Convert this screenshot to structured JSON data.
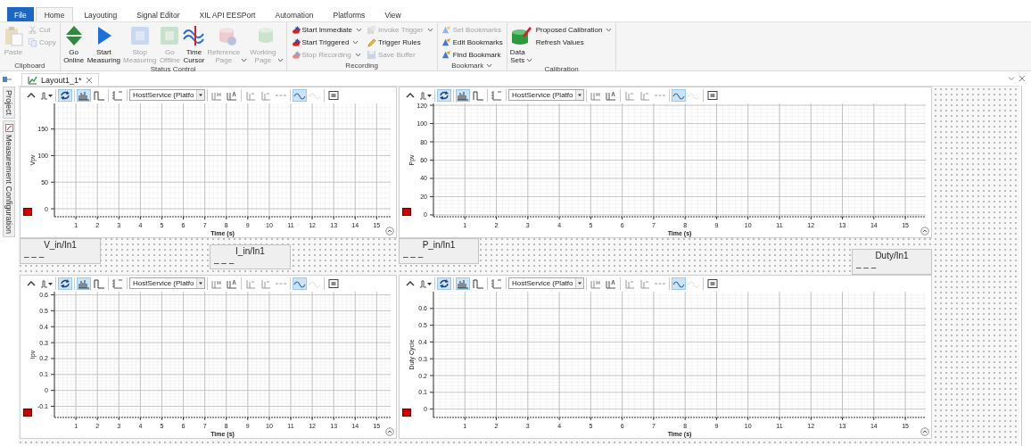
{
  "ribbon_tabs": [
    {
      "label": "File",
      "kind": "file",
      "selected": false
    },
    {
      "label": "Home",
      "kind": "tab",
      "selected": true
    },
    {
      "label": "Layouting",
      "kind": "tab",
      "selected": false
    },
    {
      "label": "Signal Editor",
      "kind": "tab",
      "selected": false
    },
    {
      "label": "XIL API EESPort",
      "kind": "tab",
      "selected": false
    },
    {
      "label": "Automation",
      "kind": "tab",
      "selected": false
    },
    {
      "label": "Platforms",
      "kind": "tab",
      "selected": false
    },
    {
      "label": "View",
      "kind": "tab",
      "selected": false
    }
  ],
  "ribbon_groups": [
    {
      "title": "Clipboard",
      "launcher": false,
      "columns": [
        {
          "kind": "large",
          "label": "Paste",
          "disabled": true,
          "dropdown": false
        },
        {
          "kind": "stack",
          "items": [
            {
              "label": "Cut",
              "disabled": true,
              "dropdown": false
            },
            {
              "label": "Copy",
              "disabled": true,
              "dropdown": false
            }
          ]
        }
      ]
    },
    {
      "title": "Status Control",
      "launcher": false,
      "columns": [
        {
          "kind": "large",
          "label": "Go Online",
          "disabled": false,
          "dropdown": false
        },
        {
          "kind": "large",
          "label": "Start Measuring",
          "disabled": false,
          "dropdown": false
        },
        {
          "kind": "large",
          "label": "Stop Measuring",
          "disabled": true,
          "dropdown": false
        },
        {
          "kind": "large",
          "label": "Go Offline",
          "disabled": true,
          "dropdown": false
        },
        {
          "kind": "large",
          "label": "Time Cursor",
          "disabled": false,
          "dropdown": false
        },
        {
          "kind": "large",
          "label": "Reference Page",
          "disabled": true,
          "dropdown": true
        },
        {
          "kind": "large",
          "label": "Working Page",
          "disabled": true,
          "dropdown": true
        }
      ]
    },
    {
      "title": "Recording",
      "launcher": false,
      "columns": [
        {
          "kind": "stack",
          "items": [
            {
              "label": "Start Immediate",
              "disabled": false,
              "dropdown": true
            },
            {
              "label": "Start Triggered",
              "disabled": false,
              "dropdown": true
            },
            {
              "label": "Stop Recording",
              "disabled": true,
              "dropdown": true
            }
          ]
        },
        {
          "kind": "stack",
          "items": [
            {
              "label": "Invoke Trigger",
              "disabled": true,
              "dropdown": true
            },
            {
              "label": "Trigger Rules",
              "disabled": false,
              "dropdown": false
            },
            {
              "label": "Save Buffer",
              "disabled": true,
              "dropdown": false
            }
          ]
        }
      ]
    },
    {
      "title": "Bookmark",
      "launcher": true,
      "columns": [
        {
          "kind": "stack",
          "items": [
            {
              "label": "Set Bookmarks",
              "disabled": true,
              "dropdown": false
            },
            {
              "label": "Edit Bookmarks",
              "disabled": false,
              "dropdown": false
            },
            {
              "label": "Find Bookmark",
              "disabled": false,
              "dropdown": false
            }
          ]
        }
      ]
    },
    {
      "title": "Calibration",
      "launcher": false,
      "columns": [
        {
          "kind": "large",
          "label": "Data Sets",
          "disabled": false,
          "dropdown": true
        },
        {
          "kind": "stack",
          "items": [
            {
              "label": "Proposed Calibration",
              "disabled": false,
              "dropdown": true
            },
            {
              "label": "Refresh Values",
              "disabled": false,
              "dropdown": false
            }
          ]
        }
      ]
    }
  ],
  "document_tab": {
    "label": "Layout1_1*"
  },
  "side_tabs": [
    {
      "label": "Project"
    },
    {
      "label": "Measurement Configuration"
    }
  ],
  "instruments": [
    {
      "kind": "plot",
      "toolbar": [
        [
          {
            "kind": "collapse",
            "on": false
          },
          {
            "kind": "signal-menu",
            "on": false
          }
        ],
        [
          {
            "kind": "refresh",
            "on": true
          }
        ],
        [
          {
            "kind": "bars",
            "on": true
          },
          {
            "kind": "step",
            "on": false
          }
        ],
        [
          {
            "kind": "axis",
            "on": false
          }
        ],
        [
          {
            "kind": "combo",
            "value": "HostService (Platfo"
          }
        ],
        [
          {
            "kind": "marker-h",
            "on": false
          },
          {
            "kind": "marker-a",
            "on": false
          }
        ],
        [
          {
            "kind": "cursor",
            "on": false
          },
          {
            "kind": "cursor",
            "on": false
          },
          {
            "kind": "dashes",
            "on": false
          }
        ],
        [
          {
            "kind": "sine",
            "on": true
          },
          {
            "kind": "dotted-sine",
            "on": false
          }
        ],
        [
          {
            "kind": "legend",
            "on": false
          }
        ]
      ],
      "chart_data": {
        "type": "line",
        "xlabel": "Time (s)",
        "ylabel": "Vpv",
        "grid": true,
        "xlim": [
          0,
          15.65
        ],
        "ylim": [
          -15,
          198
        ],
        "xticks": [
          1,
          2,
          3,
          4,
          5,
          6,
          7,
          8,
          9,
          10,
          11,
          12,
          13,
          14,
          15
        ],
        "yticks": [
          0,
          50,
          100,
          150
        ]
      }
    },
    {
      "kind": "plot",
      "toolbar": [
        [
          {
            "kind": "collapse",
            "on": false
          },
          {
            "kind": "signal-menu",
            "on": false
          }
        ],
        [
          {
            "kind": "refresh",
            "on": true
          }
        ],
        [
          {
            "kind": "bars",
            "on": true
          },
          {
            "kind": "step",
            "on": false
          }
        ],
        [
          {
            "kind": "axis",
            "on": false
          }
        ],
        [
          {
            "kind": "combo",
            "value": "HostService (Platfo"
          }
        ],
        [
          {
            "kind": "marker-h",
            "on": false
          },
          {
            "kind": "marker-a",
            "on": false
          }
        ],
        [
          {
            "kind": "cursor",
            "on": false
          },
          {
            "kind": "cursor",
            "on": false
          },
          {
            "kind": "dashes",
            "on": false
          }
        ],
        [
          {
            "kind": "sine",
            "on": true
          },
          {
            "kind": "dotted-sine",
            "on": false
          }
        ],
        [
          {
            "kind": "legend",
            "on": false
          }
        ]
      ],
      "chart_data": {
        "type": "line",
        "xlabel": "Time (s)",
        "ylabel": "Ppv",
        "grid": true,
        "xlim": [
          0,
          15.65
        ],
        "ylim": [
          -2,
          122
        ],
        "xticks": [
          1,
          2,
          3,
          4,
          5,
          6,
          7,
          8,
          9,
          10,
          11,
          12,
          13,
          14,
          15
        ],
        "yticks": [
          0,
          20,
          40,
          60,
          80,
          100,
          120
        ]
      }
    },
    {
      "kind": "display",
      "title": "V_in/In1",
      "value": "– – –"
    },
    {
      "kind": "display",
      "title": "I_in/In1",
      "value": "– – –"
    },
    {
      "kind": "display",
      "title": "P_in/In1",
      "value": "– – –"
    },
    {
      "kind": "display",
      "title": "Duty/In1",
      "value": "– – –"
    },
    {
      "kind": "plot",
      "toolbar": [
        [
          {
            "kind": "collapse",
            "on": false
          },
          {
            "kind": "signal-menu",
            "on": false
          }
        ],
        [
          {
            "kind": "refresh",
            "on": true
          }
        ],
        [
          {
            "kind": "bars",
            "on": true
          },
          {
            "kind": "step",
            "on": false
          }
        ],
        [
          {
            "kind": "axis",
            "on": false
          }
        ],
        [
          {
            "kind": "combo",
            "value": "HostService (Platfo"
          }
        ],
        [
          {
            "kind": "marker-h",
            "on": false
          },
          {
            "kind": "marker-a",
            "on": false
          }
        ],
        [
          {
            "kind": "cursor",
            "on": false
          },
          {
            "kind": "cursor",
            "on": false
          },
          {
            "kind": "dashes",
            "on": false
          }
        ],
        [
          {
            "kind": "sine",
            "on": true
          },
          {
            "kind": "dotted-sine",
            "on": false
          }
        ],
        [
          {
            "kind": "legend",
            "on": false
          }
        ]
      ],
      "chart_data": {
        "type": "line",
        "xlabel": "Time (s)",
        "ylabel": "Ipv",
        "grid": true,
        "xlim": [
          0,
          15.65
        ],
        "ylim": [
          -0.17,
          0.62
        ],
        "xticks": [
          1,
          2,
          3,
          4,
          5,
          6,
          7,
          8,
          9,
          10,
          11,
          12,
          13,
          14,
          15
        ],
        "yticks": [
          -0.1,
          0,
          0.1,
          0.2,
          0.3,
          0.4,
          0.5,
          0.6
        ]
      }
    },
    {
      "kind": "plot",
      "toolbar": [
        [
          {
            "kind": "collapse",
            "on": false
          },
          {
            "kind": "signal-menu",
            "on": false
          }
        ],
        [
          {
            "kind": "refresh",
            "on": true
          }
        ],
        [
          {
            "kind": "bars",
            "on": true
          },
          {
            "kind": "step",
            "on": false
          }
        ],
        [
          {
            "kind": "axis",
            "on": false
          }
        ],
        [
          {
            "kind": "combo",
            "value": "HostService (Platfo"
          }
        ],
        [
          {
            "kind": "marker-h",
            "on": false
          },
          {
            "kind": "marker-a",
            "on": false
          }
        ],
        [
          {
            "kind": "cursor",
            "on": false
          },
          {
            "kind": "cursor",
            "on": false
          },
          {
            "kind": "dashes",
            "on": false
          }
        ],
        [
          {
            "kind": "sine",
            "on": true
          },
          {
            "kind": "dotted-sine",
            "on": false
          }
        ],
        [
          {
            "kind": "legend",
            "on": false
          }
        ]
      ],
      "chart_data": {
        "type": "line",
        "xlabel": "Time (s)",
        "ylabel": "Duty Cycle",
        "grid": true,
        "xlim": [
          0,
          15.65
        ],
        "ylim": [
          -0.05,
          0.7
        ],
        "xticks": [
          1,
          2,
          3,
          4,
          5,
          6,
          7,
          8,
          9,
          10,
          11,
          12,
          13,
          14,
          15
        ],
        "yticks": [
          0,
          0.1,
          0.2,
          0.3,
          0.4,
          0.5,
          0.6
        ]
      }
    }
  ]
}
